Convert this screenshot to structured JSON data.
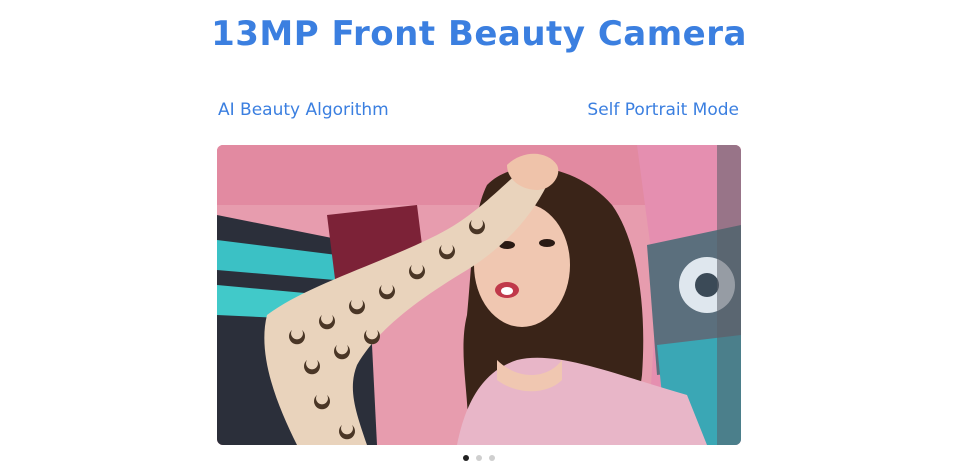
{
  "title": "13MP Front Beauty Camera",
  "features": {
    "left": "AI Beauty Algorithm",
    "right": "Self Portrait Mode"
  },
  "colors": {
    "accent": "#3b7fe0",
    "dot_active": "#222222",
    "dot_inactive": "#cfcfcf"
  },
  "carousel": {
    "active_index": 0,
    "dots": [
      "slide-1",
      "slide-2",
      "slide-3"
    ]
  }
}
